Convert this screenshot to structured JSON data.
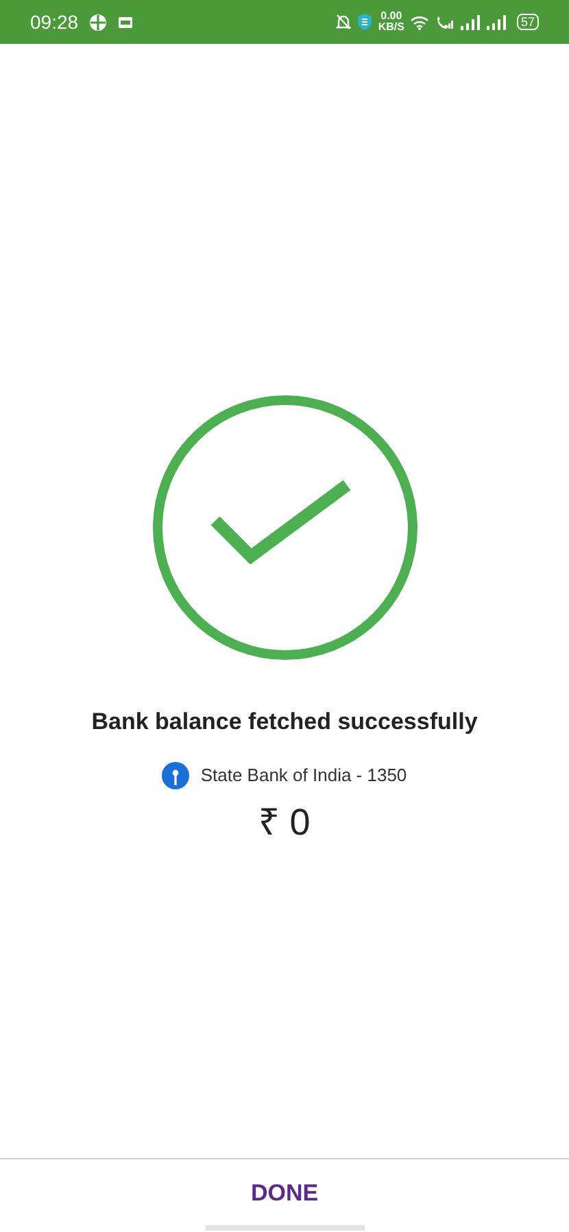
{
  "status_bar": {
    "time": "09:28",
    "network_speed": "0.00",
    "network_unit": "KB/S",
    "battery": "57"
  },
  "result": {
    "title": "Bank balance fetched successfully",
    "account": "State Bank of India - 1350",
    "balance": "₹ 0"
  },
  "buttons": [
    "DONE"
  ]
}
